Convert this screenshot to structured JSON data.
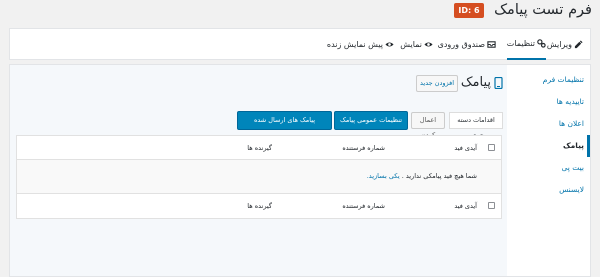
{
  "header": {
    "title": "فرم تست پیامک",
    "id_badge": "ID: 6"
  },
  "tabs": [
    {
      "label": "ویرایش",
      "icon": "edit-icon"
    },
    {
      "label": "تنظیمات",
      "icon": "settings-cogs-icon",
      "active": true
    },
    {
      "label": "صندوق ورودی",
      "icon": "inbox-icon"
    },
    {
      "label": "نمایش",
      "icon": "eye-icon"
    },
    {
      "label": "پیش نمایش زنده",
      "icon": "live-preview-icon"
    }
  ],
  "sidebar": {
    "items": [
      {
        "label": "تنظیمات فرم"
      },
      {
        "label": "تاییدیه ها"
      },
      {
        "label": "اعلان ها"
      },
      {
        "label": "پیامک",
        "active": true
      },
      {
        "label": "بیت پی"
      },
      {
        "label": "لایسنس"
      }
    ]
  },
  "main": {
    "heading": "پیامک",
    "add_new_label": "افزودن جدید",
    "bulk_actions_label": "اقدامات دسته جمعی",
    "apply_label": "اعمال کردن",
    "general_settings_label": "تنظیمات عمومی پیامک",
    "sent_sms_label": "پیامک های ارسال شده",
    "table": {
      "columns": [
        "آیدی فید",
        "شماره فرستنده",
        "گیرنده ها"
      ],
      "empty_message": "شما هیچ فید پیامکی ندارید .",
      "create_link": "یکی بسازید."
    }
  },
  "colors": {
    "accent": "#0073aa",
    "button_primary": "#0085ba",
    "id_badge": "#d54e21"
  }
}
